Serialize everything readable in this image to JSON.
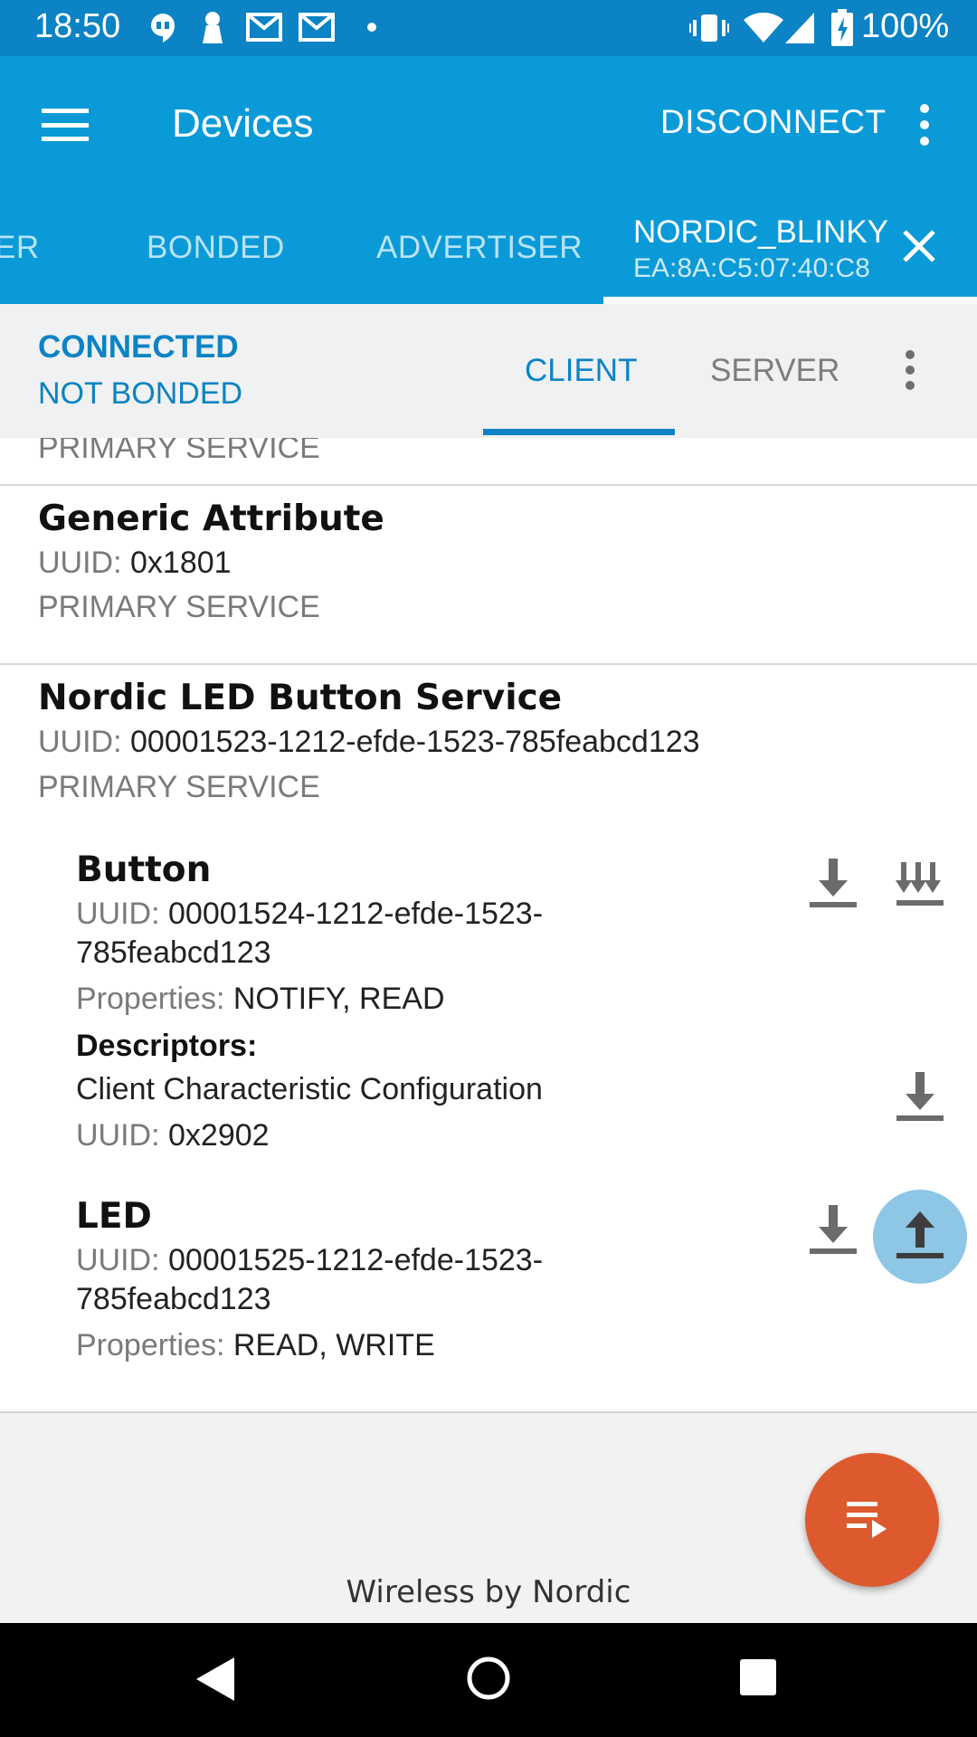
{
  "status_bar": {
    "time": "18:50",
    "battery": "100%"
  },
  "app_bar": {
    "title": "Devices",
    "disconnect_label": "DISCONNECT"
  },
  "tabs": {
    "cut_label": "ER",
    "bonded": "BONDED",
    "advertiser": "ADVERTISER",
    "device_name": "NORDIC_BLINKY",
    "device_address": "EA:8A:C5:07:40:C8"
  },
  "connection": {
    "status": "CONNECTED",
    "bond": "NOT BONDED",
    "client_tab": "CLIENT",
    "server_tab": "SERVER"
  },
  "services": {
    "partial_type": "PRIMARY SERVICE",
    "generic_attribute": {
      "name": "Generic Attribute",
      "uuid_label": "UUID:",
      "uuid": "0x1801",
      "type": "PRIMARY SERVICE"
    },
    "led_button": {
      "name": "Nordic LED Button Service",
      "uuid_label": "UUID:",
      "uuid": "00001523-1212-efde-1523-785feabcd123",
      "type": "PRIMARY SERVICE"
    }
  },
  "characteristics": {
    "button": {
      "name": "Button",
      "uuid_label": "UUID:",
      "uuid_line1": "00001524-1212-efde-1523-",
      "uuid_line2": "785feabcd123",
      "properties_label": "Properties:",
      "properties": "NOTIFY, READ",
      "descriptors_label": "Descriptors:",
      "descriptor_name": "Client Characteristic Configuration",
      "descriptor_uuid_label": "UUID:",
      "descriptor_uuid": "0x2902"
    },
    "led": {
      "name": "LED",
      "uuid_label": "UUID:",
      "uuid_line1": "00001525-1212-efde-1523-",
      "uuid_line2": "785feabcd123",
      "properties_label": "Properties:",
      "properties": "READ, WRITE"
    }
  },
  "footer": {
    "text": "Wireless by Nordic"
  },
  "colors": {
    "status_bar": "#0b83c4",
    "app_bar": "#0a9ad8",
    "accent": "#0b83c4",
    "fab": "#dd5a2f",
    "write_highlight": "#8ec6e6"
  }
}
